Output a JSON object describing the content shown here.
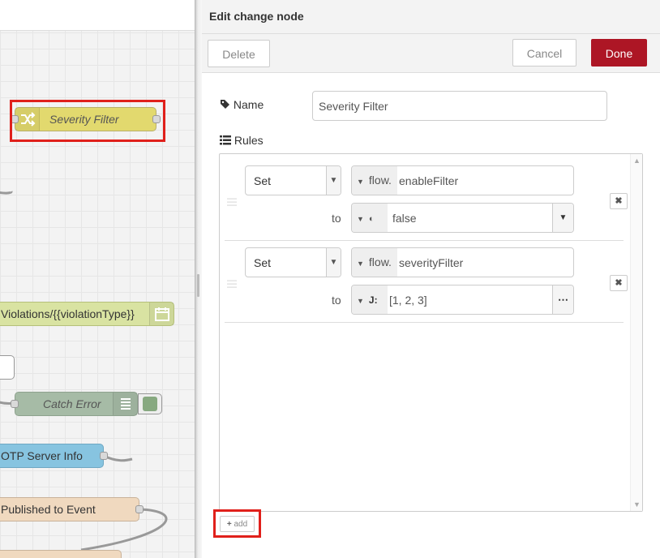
{
  "workspace": {
    "nodes": [
      {
        "label": "Severity Filter",
        "icon": "shuffle-icon",
        "selected": true
      },
      {
        "label": "Violations/{{violationType}}",
        "icon": "calendar-icon"
      },
      {
        "label": "Catch Error",
        "icon": "list-icon"
      },
      {
        "label": "OTP Server Info"
      },
      {
        "label": "Published to Event"
      }
    ]
  },
  "tray": {
    "title": "Edit change node",
    "delete_label": "Delete",
    "cancel_label": "Cancel",
    "done_label": "Done",
    "name_label": "Name",
    "name_value": "Severity Filter",
    "rules_label": "Rules",
    "rules": [
      {
        "action": "Set",
        "target_type": "flow.",
        "target": "enableFilter",
        "to_label": "to",
        "value_type_icon": "boolean-icon",
        "value": "false"
      },
      {
        "action": "Set",
        "target_type": "flow.",
        "target": "severityFilter",
        "to_label": "to",
        "value_type_icon": "json-icon",
        "value": "[1, 2, 3]"
      }
    ],
    "add_label": "add"
  },
  "colors": {
    "done": "#ad1625",
    "highlight": "#e0201b"
  }
}
